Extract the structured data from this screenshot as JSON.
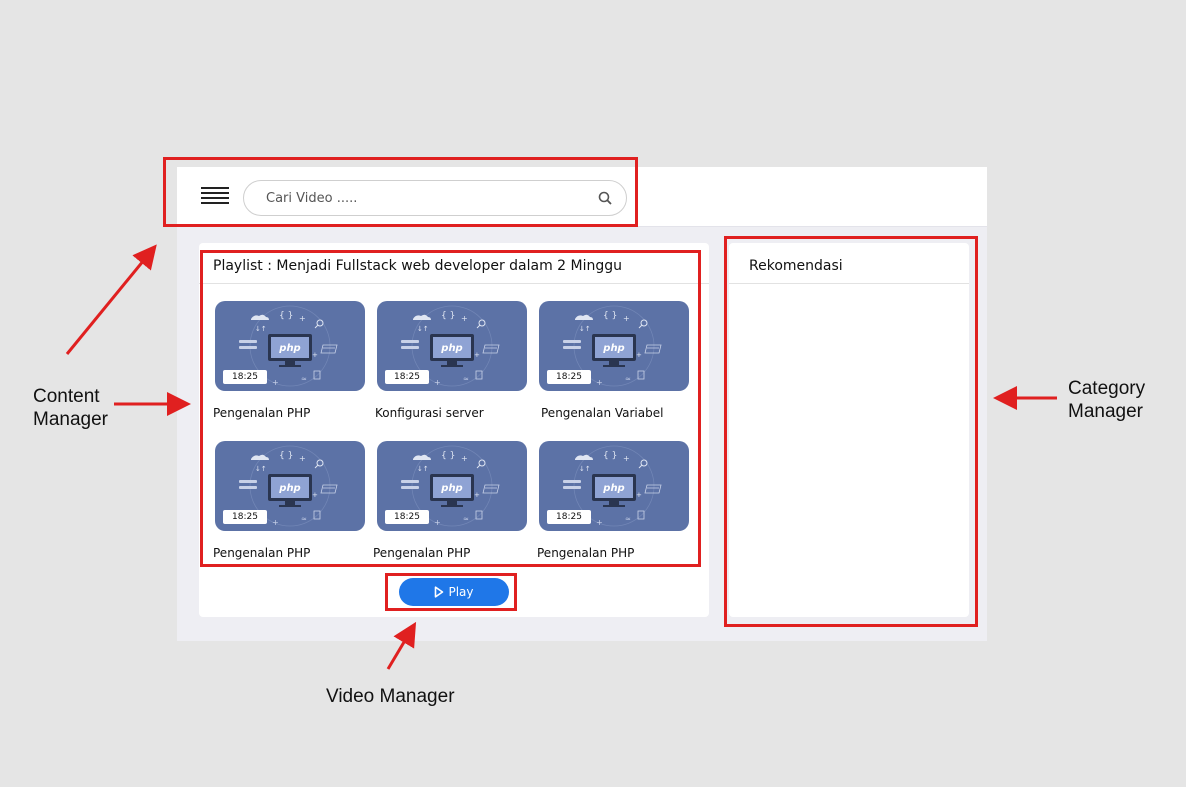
{
  "search": {
    "placeholder": "Cari Video ....."
  },
  "playlist": {
    "title": "Playlist : Menjadi Fullstack web developer dalam 2 Minggu",
    "videos": [
      {
        "title": "Pengenalan PHP",
        "duration": "18:25",
        "badge": "php"
      },
      {
        "title": "Konfigurasi server",
        "duration": "18:25",
        "badge": "php"
      },
      {
        "title": "Pengenalan Variabel",
        "duration": "18:25",
        "badge": "php"
      },
      {
        "title": "Pengenalan PHP",
        "duration": "18:25",
        "badge": "php"
      },
      {
        "title": "Pengenalan PHP",
        "duration": "18:25",
        "badge": "php"
      },
      {
        "title": "Pengenalan PHP",
        "duration": "18:25",
        "badge": "php"
      }
    ],
    "play_label": "Play"
  },
  "recommendations": {
    "title": "Rekomendasi"
  },
  "annotations": {
    "content_manager": "Content\nManager",
    "category_manager": "Category\nManager",
    "video_manager": "Video Manager"
  },
  "colors": {
    "accent": "#1f77e8",
    "annotation": "#e02020",
    "thumbnail": "#5c72a6"
  },
  "icons": {
    "menu": "hamburger-icon",
    "search": "search-icon",
    "play": "play-icon"
  }
}
